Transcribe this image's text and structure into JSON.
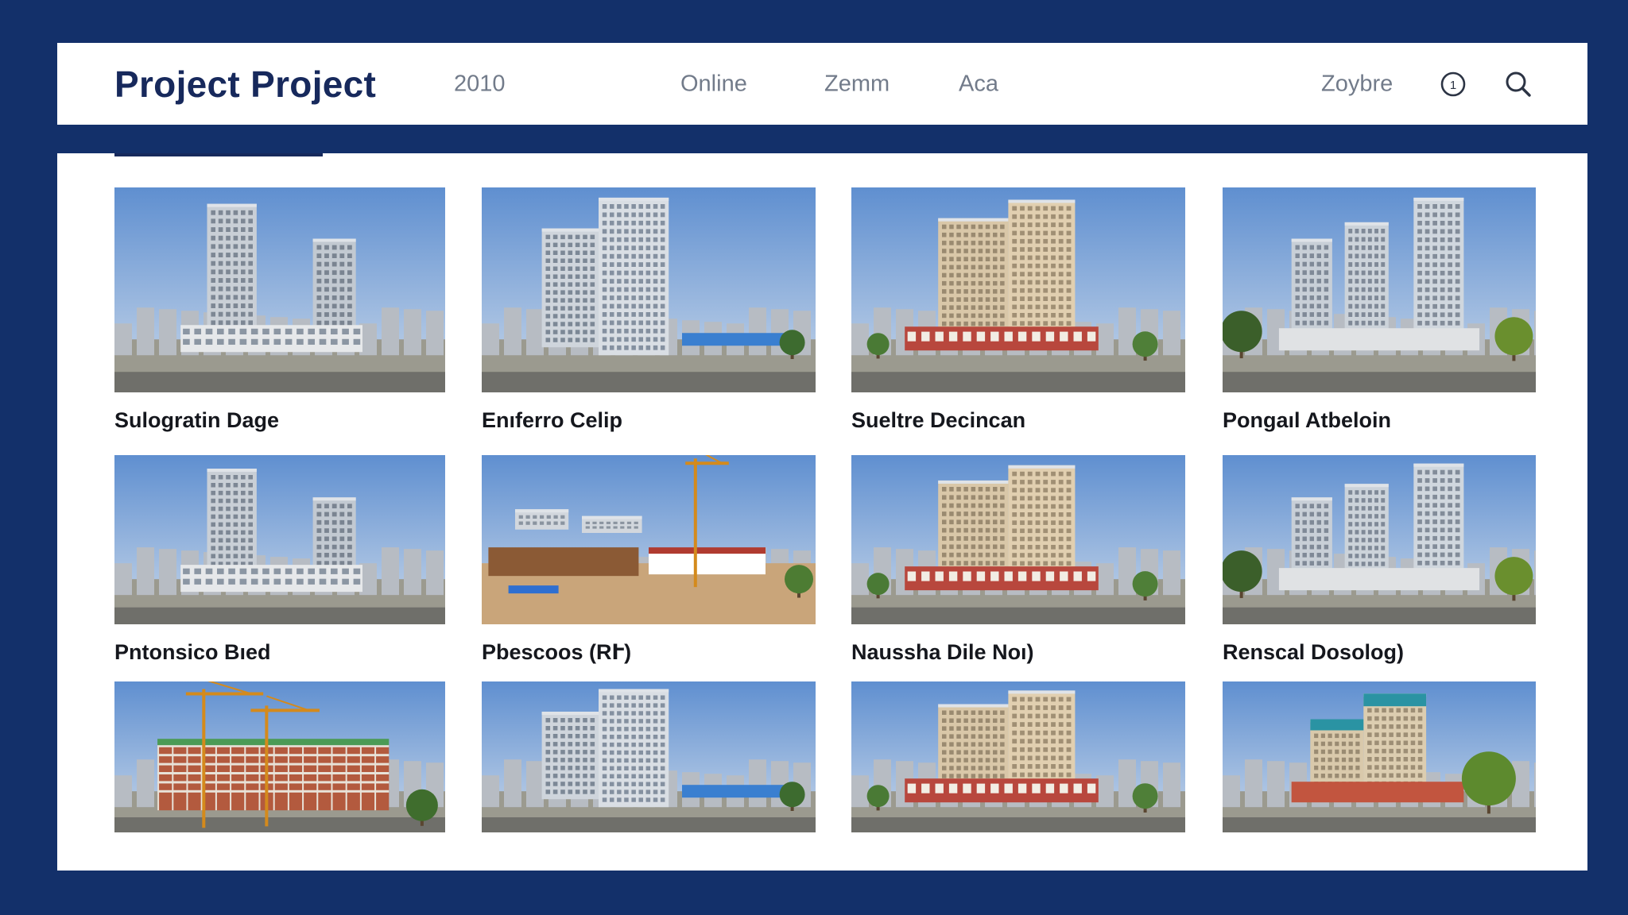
{
  "header": {
    "brand": "Project Project",
    "year": "2010",
    "nav": [
      "Online",
      "Zemm",
      "Aca"
    ],
    "user": "Zoybre",
    "icons": [
      "info-icon",
      "search-icon"
    ]
  },
  "colors": {
    "page_bg": "#13306a",
    "brand_text": "#17295c",
    "nav_text": "#727b8a",
    "title_text": "#15171d"
  },
  "projects": [
    {
      "title": "Sulogratin Dage",
      "scene": "towers"
    },
    {
      "title": "Enıferro Celip",
      "scene": "tower-city"
    },
    {
      "title": "Sueltre Decincan",
      "scene": "beige-towers"
    },
    {
      "title": "Pongaıl Atbeloin",
      "scene": "three-towers"
    },
    {
      "title": "Pntonsico Bıed",
      "scene": "towers"
    },
    {
      "title": "Pbescoos (RՒ)",
      "scene": "construction-site"
    },
    {
      "title": "Naussha Dile Noı)",
      "scene": "beige-towers"
    },
    {
      "title": "Renscal Dosolog)",
      "scene": "three-towers"
    },
    {
      "title": "",
      "scene": "crane-frame"
    },
    {
      "title": "",
      "scene": "tower-city"
    },
    {
      "title": "",
      "scene": "beige-towers"
    },
    {
      "title": "",
      "scene": "teal-towers"
    }
  ]
}
